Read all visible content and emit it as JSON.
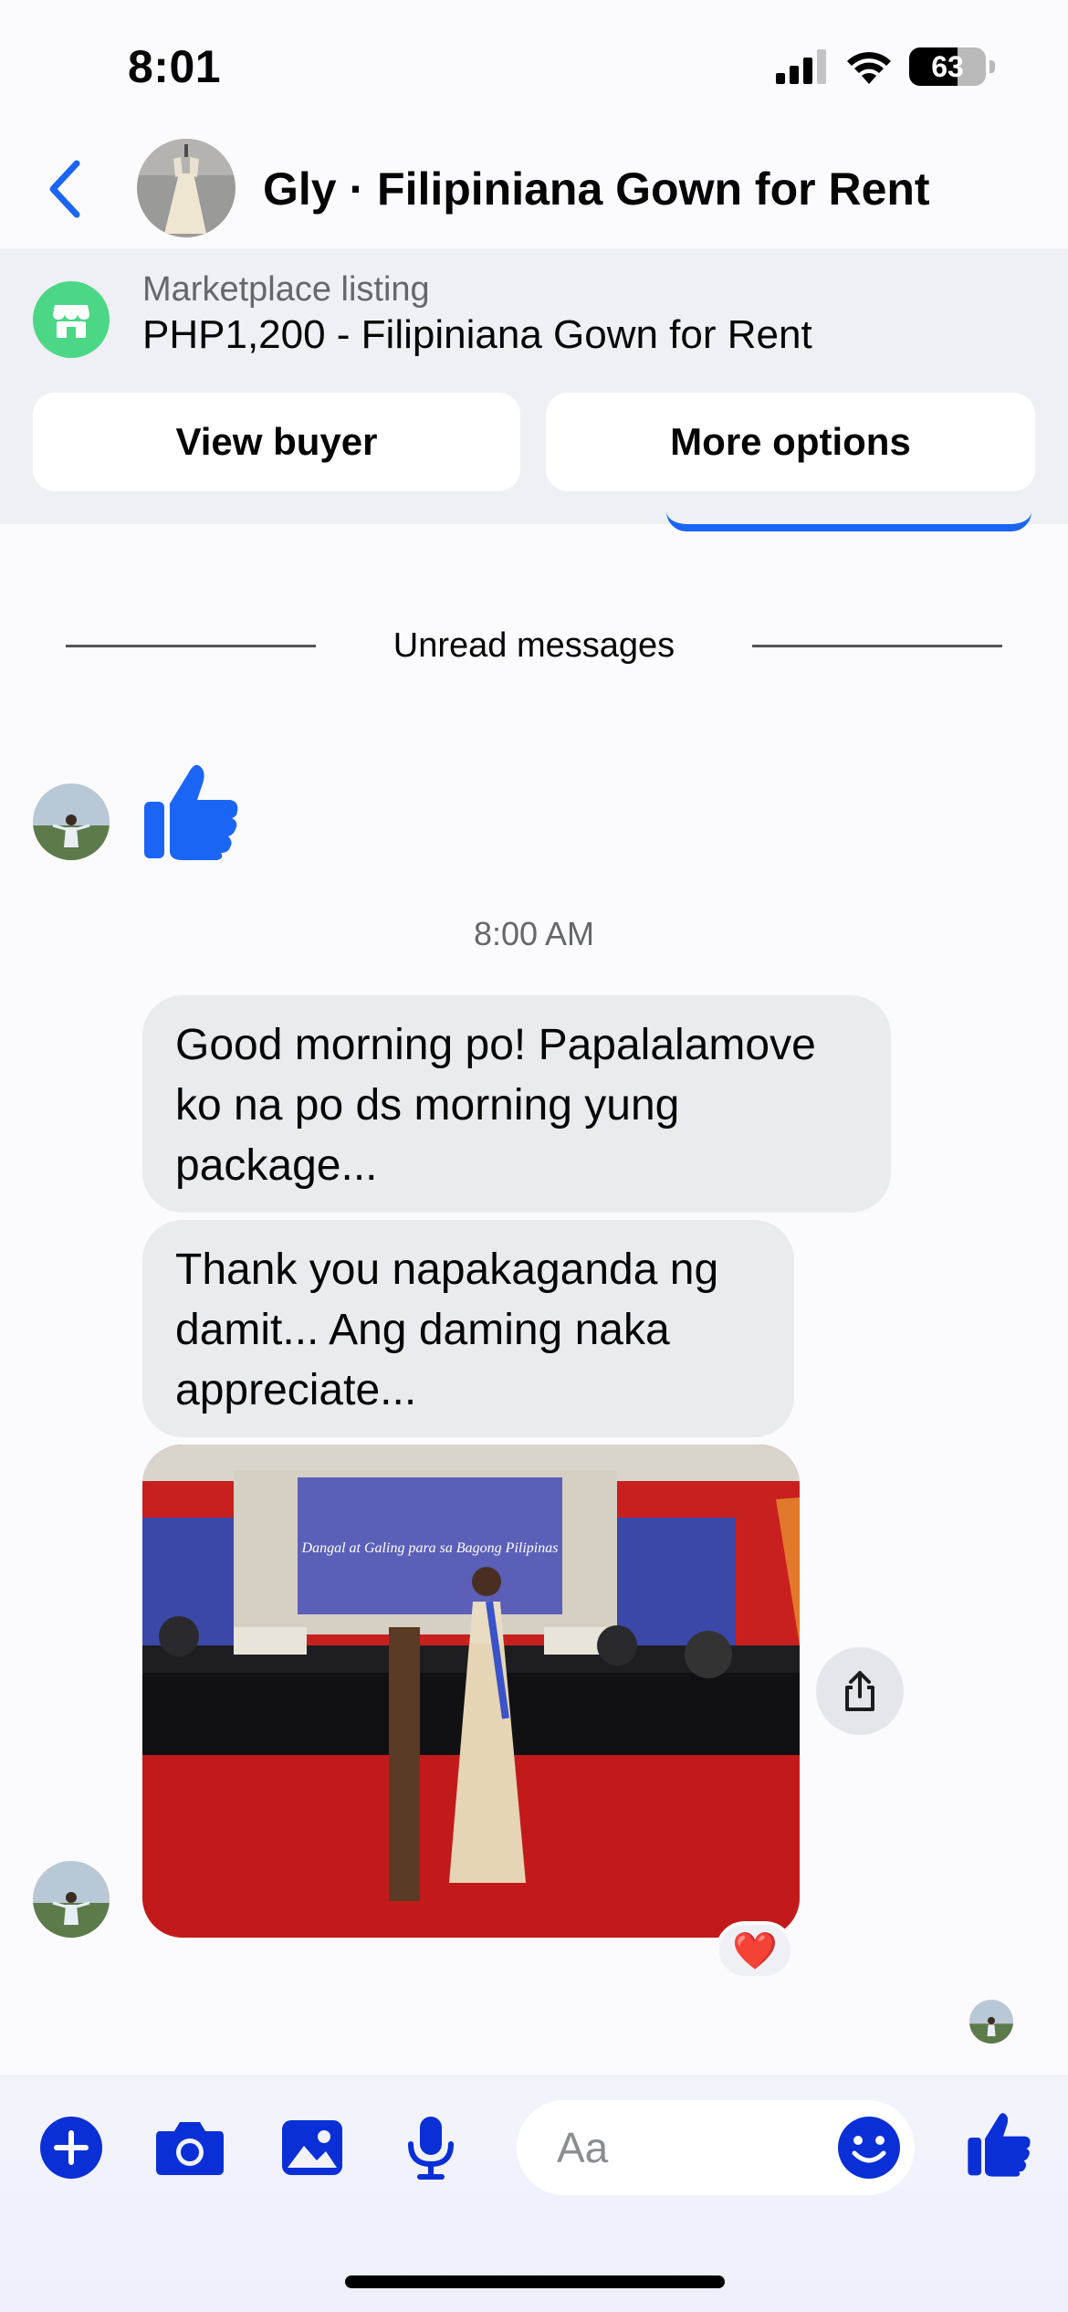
{
  "status_bar": {
    "time": "8:01",
    "battery": "63"
  },
  "header": {
    "title": "Gly · Filipiniana Gown for Rent"
  },
  "listing": {
    "label": "Marketplace listing",
    "name": "PHP1,200 - Filipiniana Gown for Rent",
    "view_buyer": "View buyer",
    "more_options": "More options"
  },
  "messages": {
    "unread_label": "Unread messages",
    "timestamp": "8:00 AM",
    "items": [
      {
        "text": "Good morning po! Papalalamove ko na po ds morning yung package..."
      },
      {
        "text": "Thank you napakaganda ng damit... Ang daming naka appreciate..."
      }
    ],
    "photo_banner": "Dangal at Galing para sa Bagong Pilipinas",
    "reaction": "❤️"
  },
  "composer": {
    "placeholder": "Aa"
  },
  "colors": {
    "accent": "#0a2fd6",
    "ios_blue": "#1b65f5",
    "bubble": "#eaebef",
    "marketplace": "#4cd787"
  }
}
